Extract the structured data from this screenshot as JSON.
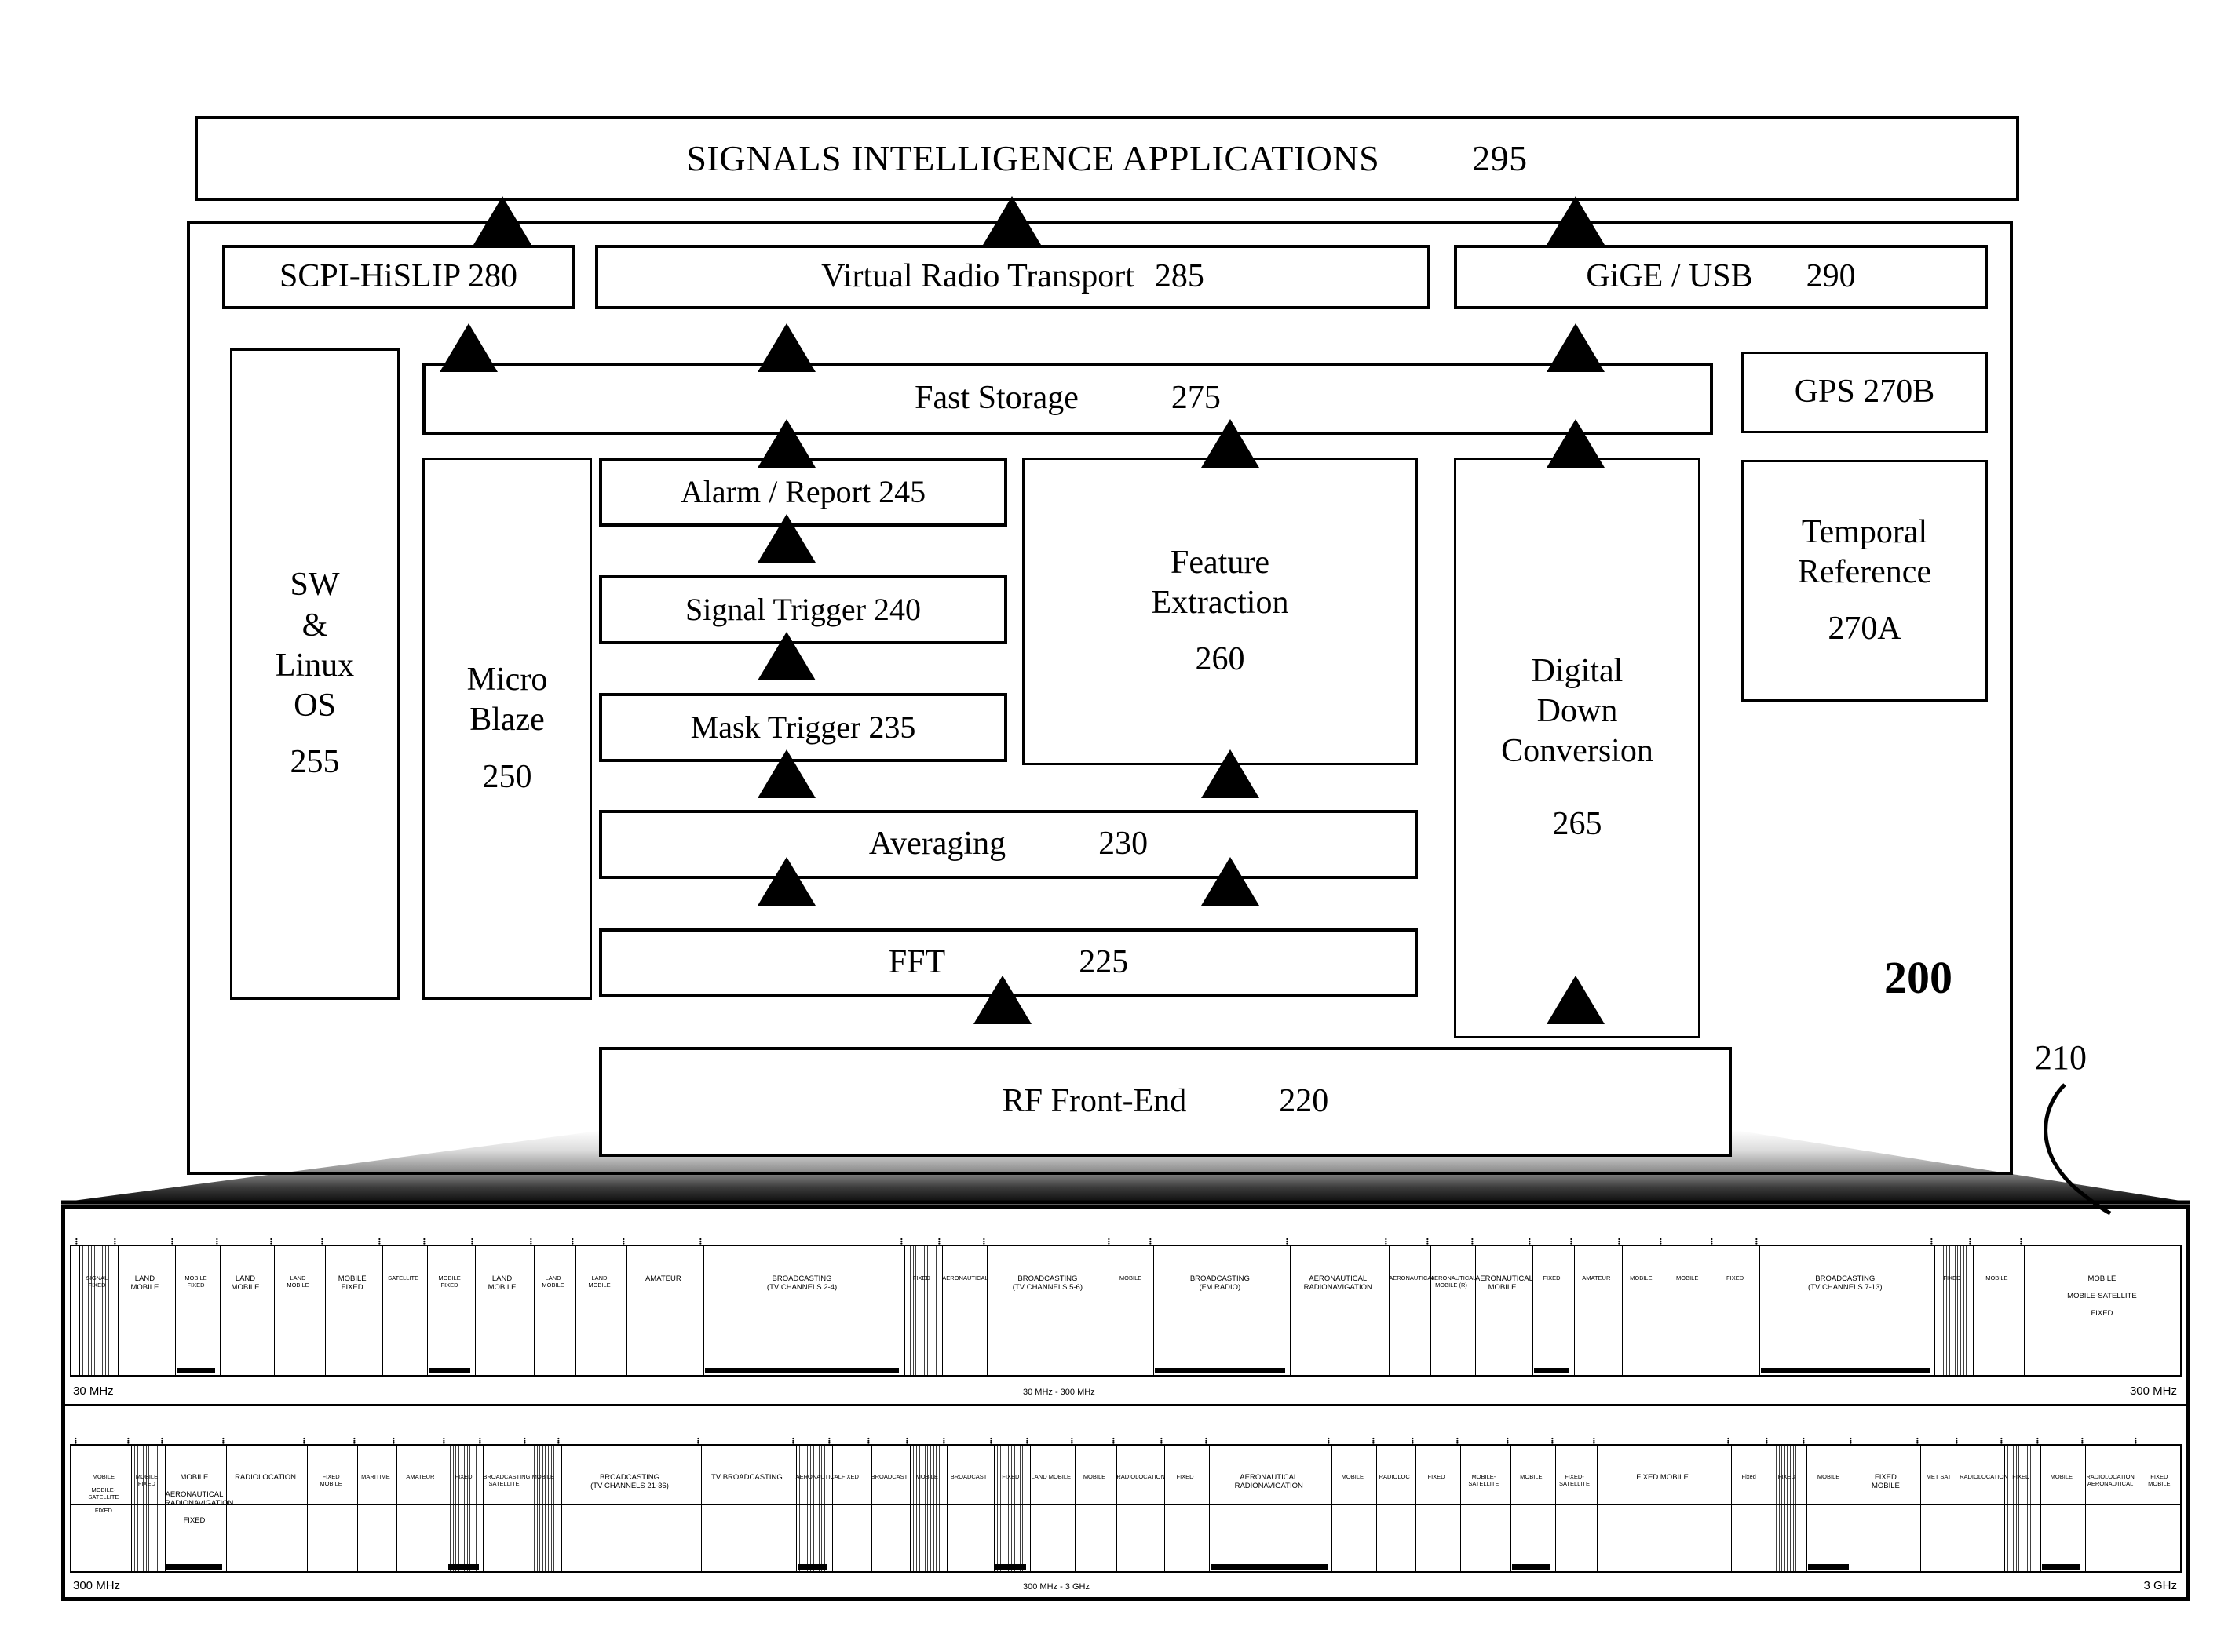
{
  "figure": {
    "system_ref": "200",
    "spectrum_ref": "210"
  },
  "blocks": {
    "applications": {
      "label": "SIGNALS INTELLIGENCE APPLICATIONS",
      "ref": "295"
    },
    "scpi_hislip": {
      "label": "SCPI-HiSLIP 280",
      "ref": "280"
    },
    "virtual_radio": {
      "label": "Virtual Radio Transport",
      "ref": "285"
    },
    "gige_usb": {
      "label": "GiGE / USB",
      "ref": "290"
    },
    "fast_storage": {
      "label": "Fast Storage",
      "ref": "275"
    },
    "gps": {
      "label": "GPS 270B",
      "ref": "270B"
    },
    "temporal_ref": {
      "line1": "Temporal",
      "line2": "Reference",
      "ref": "270A"
    },
    "sw_linux": {
      "line1": "SW",
      "line2": "&",
      "line3": "Linux",
      "line4": "OS",
      "ref": "255"
    },
    "microblaze": {
      "line1": "Micro",
      "line2": "Blaze",
      "ref": "250"
    },
    "alarm_report": {
      "label": "Alarm / Report  245",
      "ref": "245"
    },
    "signal_trigger": {
      "label": "Signal Trigger  240",
      "ref": "240"
    },
    "mask_trigger": {
      "label": "Mask Trigger   235",
      "ref": "235"
    },
    "averaging": {
      "label": "Averaging",
      "ref": "230"
    },
    "fft": {
      "label": "FFT",
      "ref": "225"
    },
    "rf_front_end": {
      "label": "RF Front-End",
      "ref": "220"
    },
    "feature_extraction": {
      "line1": "Feature",
      "line2": "Extraction",
      "ref": "260"
    },
    "ddc": {
      "line1": "Digital",
      "line2": "Down",
      "line3": "Conversion",
      "ref": "265"
    }
  },
  "spectrum": {
    "row1": {
      "left_label": "30 MHz",
      "right_label": "300 MHz",
      "center_label": "30 MHz - 300 MHz",
      "bands": [
        {
          "x": 0.5,
          "w": 2.2,
          "text": "SIGNAL\nFIXED"
        },
        {
          "x": 2.9,
          "w": 3.4,
          "text": "LAND\nMOBILE"
        },
        {
          "x": 6.5,
          "w": 2.6,
          "text": "MOBILE\nFIXED"
        },
        {
          "x": 9.3,
          "w": 3.2,
          "text": "LAND\nMOBILE"
        },
        {
          "x": 12.7,
          "w": 3.0,
          "text": "LAND\nMOBILE"
        },
        {
          "x": 15.9,
          "w": 3.4,
          "text": "MOBILE\nFIXED"
        },
        {
          "x": 19.5,
          "w": 2.6,
          "text": "SATELLITE"
        },
        {
          "x": 22.3,
          "w": 2.8,
          "text": "MOBILE\nFIXED"
        },
        {
          "x": 25.3,
          "w": 3.4,
          "text": "LAND\nMOBILE"
        },
        {
          "x": 29.0,
          "w": 2.4,
          "text": "LAND\nMOBILE"
        },
        {
          "x": 31.6,
          "w": 3.0,
          "text": "LAND\nMOBILE"
        },
        {
          "x": 34.8,
          "w": 4.6,
          "text": "AMATEUR"
        },
        {
          "x": 39.6,
          "w": 12.4,
          "text": "BROADCASTING\n(TV CHANNELS 2-4)"
        },
        {
          "x": 52.2,
          "w": 2.2,
          "text": "FIXED"
        },
        {
          "x": 54.6,
          "w": 2.6,
          "text": "AERONAUTICAL"
        },
        {
          "x": 57.4,
          "w": 7.6,
          "text": "BROADCASTING\n(TV CHANNELS 5-6)"
        },
        {
          "x": 65.2,
          "w": 2.4,
          "text": "MOBILE"
        },
        {
          "x": 67.8,
          "w": 8.4,
          "text": "BROADCASTING\n(FM RADIO)"
        },
        {
          "x": 76.4,
          "w": 6.0,
          "text": "AERONAUTICAL\nRADIONAVIGATION"
        },
        {
          "x": 82.6,
          "w": 2.4,
          "text": "AERONAUTICAL"
        },
        {
          "x": 85.2,
          "w": 2.6,
          "text": "AERONAUTICAL\nMOBILE (R)"
        },
        {
          "x": 88.0,
          "w": 3.4,
          "text": "AERONAUTICAL MOBILE"
        },
        {
          "x": 91.6,
          "w": 2.4,
          "text": "FIXED"
        },
        {
          "x": 94.2,
          "w": 2.8,
          "text": "AMATEUR"
        },
        {
          "x": 97.2,
          "w": 2.4,
          "text": "MOBILE"
        },
        {
          "x": 99.8,
          "w": 3.0,
          "text": "MOBILE"
        },
        {
          "x": 103.0,
          "w": 2.6,
          "text": "FIXED"
        },
        {
          "x": 105.8,
          "w": 10.8,
          "text": "BROADCASTING\n(TV CHANNELS 7-13)"
        },
        {
          "x": 116.8,
          "w": 2.2,
          "text": "FIXED"
        },
        {
          "x": 119.2,
          "w": 3.0,
          "text": "MOBILE"
        },
        {
          "x": 122.4,
          "w": 9.8,
          "text": "MOBILE\n\nMOBILE-SATELLITE\n\nFIXED"
        }
      ]
    },
    "row2": {
      "left_label": "300 MHz",
      "right_label": "3 GHz",
      "center_label": "300 MHz - 3 GHz",
      "bands": [
        {
          "x": 0.5,
          "w": 3.6,
          "text": "MOBILE\n\nMOBILE-\nSATELLITE\n\nFIXED"
        },
        {
          "x": 4.3,
          "w": 2.2,
          "text": "MOBILE\nFIXED"
        },
        {
          "x": 6.7,
          "w": 4.2,
          "text": "MOBILE\n\nAERONAUTICAL\nRADIONAVIGATION\n\nFIXED"
        },
        {
          "x": 11.1,
          "w": 5.6,
          "text": "RADIOLOCATION"
        },
        {
          "x": 16.9,
          "w": 3.4,
          "text": "FIXED\nMOBILE"
        },
        {
          "x": 20.5,
          "w": 2.6,
          "text": "MARITIME"
        },
        {
          "x": 23.3,
          "w": 3.4,
          "text": "AMATEUR"
        },
        {
          "x": 26.9,
          "w": 2.4,
          "text": "FIXED"
        },
        {
          "x": 29.5,
          "w": 3.0,
          "text": "BROADCASTING\nSATELLITE"
        },
        {
          "x": 32.7,
          "w": 2.2,
          "text": "MOBILE"
        },
        {
          "x": 35.1,
          "w": 9.8,
          "text": "BROADCASTING\n(TV CHANNELS 21-36)"
        },
        {
          "x": 45.1,
          "w": 6.6,
          "text": "TV BROADCASTING"
        },
        {
          "x": 51.9,
          "w": 2.4,
          "text": "AERONAUTICAL"
        },
        {
          "x": 54.5,
          "w": 2.6,
          "text": "FIXED"
        },
        {
          "x": 57.3,
          "w": 2.6,
          "text": "BROADCAST"
        },
        {
          "x": 60.1,
          "w": 2.4,
          "text": "MOBILE"
        },
        {
          "x": 62.7,
          "w": 3.2,
          "text": "BROADCAST"
        },
        {
          "x": 66.1,
          "w": 2.4,
          "text": "FIXED"
        },
        {
          "x": 68.7,
          "w": 3.0,
          "text": "LAND MOBILE"
        },
        {
          "x": 71.9,
          "w": 2.8,
          "text": "MOBILE"
        },
        {
          "x": 74.9,
          "w": 3.2,
          "text": "RADIOLOCATION"
        },
        {
          "x": 78.3,
          "w": 3.0,
          "text": "FIXED"
        },
        {
          "x": 81.5,
          "w": 8.6,
          "text": "AERONAUTICAL\nRADIONAVIGATION"
        },
        {
          "x": 90.3,
          "w": 3.0,
          "text": "MOBILE"
        },
        {
          "x": 93.5,
          "w": 2.6,
          "text": "RADIOLOC"
        },
        {
          "x": 96.3,
          "w": 3.0,
          "text": "FIXED"
        },
        {
          "x": 99.5,
          "w": 3.4,
          "text": "MOBILE-SATELLITE"
        },
        {
          "x": 103.1,
          "w": 3.0,
          "text": "MOBILE"
        },
        {
          "x": 106.3,
          "w": 2.8,
          "text": "FIXED-SATELLITE"
        },
        {
          "x": 109.3,
          "w": 9.4,
          "text": "FIXED  MOBILE"
        },
        {
          "x": 118.9,
          "w": 2.6,
          "text": "Fixed"
        },
        {
          "x": 121.7,
          "w": 2.4,
          "text": "FIXED"
        },
        {
          "x": 124.3,
          "w": 3.2,
          "text": "MOBILE"
        },
        {
          "x": 127.7,
          "w": 4.6,
          "text": "FIXED\nMOBILE"
        },
        {
          "x": 132.5,
          "w": 2.6,
          "text": "MET SAT"
        },
        {
          "x": 135.3,
          "w": 3.0,
          "text": "RADIOLOCATION"
        },
        {
          "x": 138.5,
          "w": 2.4,
          "text": "FIXED"
        },
        {
          "x": 141.1,
          "w": 3.0,
          "text": "MOBILE"
        },
        {
          "x": 144.3,
          "w": 3.6,
          "text": "RADIOLOCATION\nAERONAUTICAL"
        },
        {
          "x": 148.1,
          "w": 3.0,
          "text": "FIXED\nMOBILE"
        }
      ]
    }
  }
}
